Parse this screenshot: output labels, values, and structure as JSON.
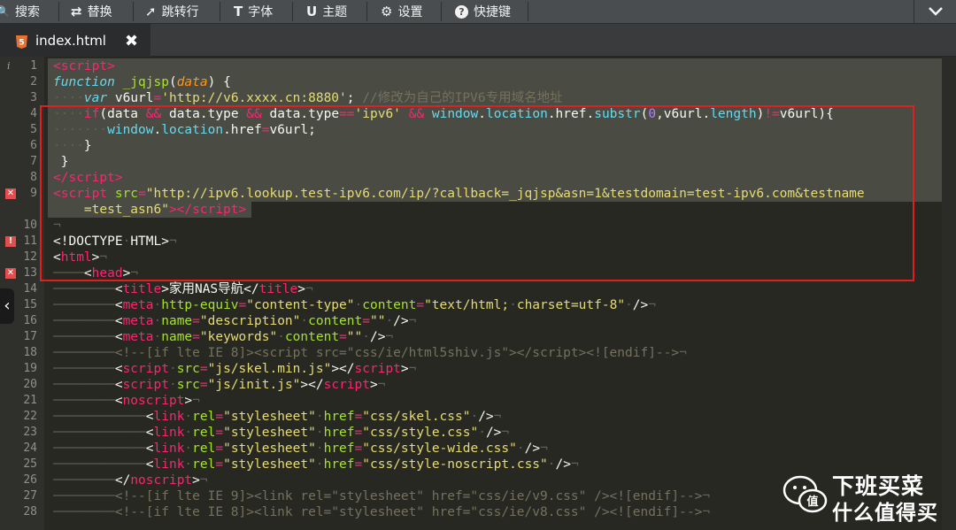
{
  "toolbar": {
    "buttons": [
      {
        "icon": "search-icon",
        "glyph": "🔍",
        "label": "搜索"
      },
      {
        "icon": "replace-icon",
        "glyph": "⇄",
        "label": "替换"
      },
      {
        "icon": "goto-line-icon",
        "glyph": "➚",
        "label": "跳转行"
      },
      {
        "icon": "font-icon",
        "glyph": "T",
        "label": "字体"
      },
      {
        "icon": "theme-icon",
        "glyph": "U",
        "label": "主题"
      },
      {
        "icon": "gear-icon",
        "glyph": "⚙",
        "label": "设置"
      },
      {
        "icon": "help-icon",
        "glyph": "?",
        "label": "快捷键"
      }
    ],
    "collapse_icon": "chevron-down-icon"
  },
  "tab": {
    "file_icon": "html5-icon",
    "name": "index.html",
    "close_icon": "close-icon"
  },
  "editor": {
    "line_numbers": [
      "1",
      "2",
      "3",
      "4",
      "5",
      "6",
      "7",
      "8",
      "9",
      "",
      "10",
      "11",
      "12",
      "13",
      "14",
      "15",
      "16",
      "17",
      "18",
      "19",
      "20",
      "21",
      "22",
      "23",
      "24",
      "25",
      "26",
      "27",
      "28"
    ],
    "line_markers": {
      "1": "info",
      "9": "error",
      "11": "error",
      "13": "error"
    },
    "selected_line_range": [
      1,
      9
    ]
  },
  "colors": {
    "background": "#272822",
    "selection_box": "#e02020",
    "toolbar": "#4a4d50"
  },
  "watermark": {
    "line1": "下班买菜",
    "line2": "什么值得买",
    "logo": "wechat-icon",
    "badge": "值"
  }
}
